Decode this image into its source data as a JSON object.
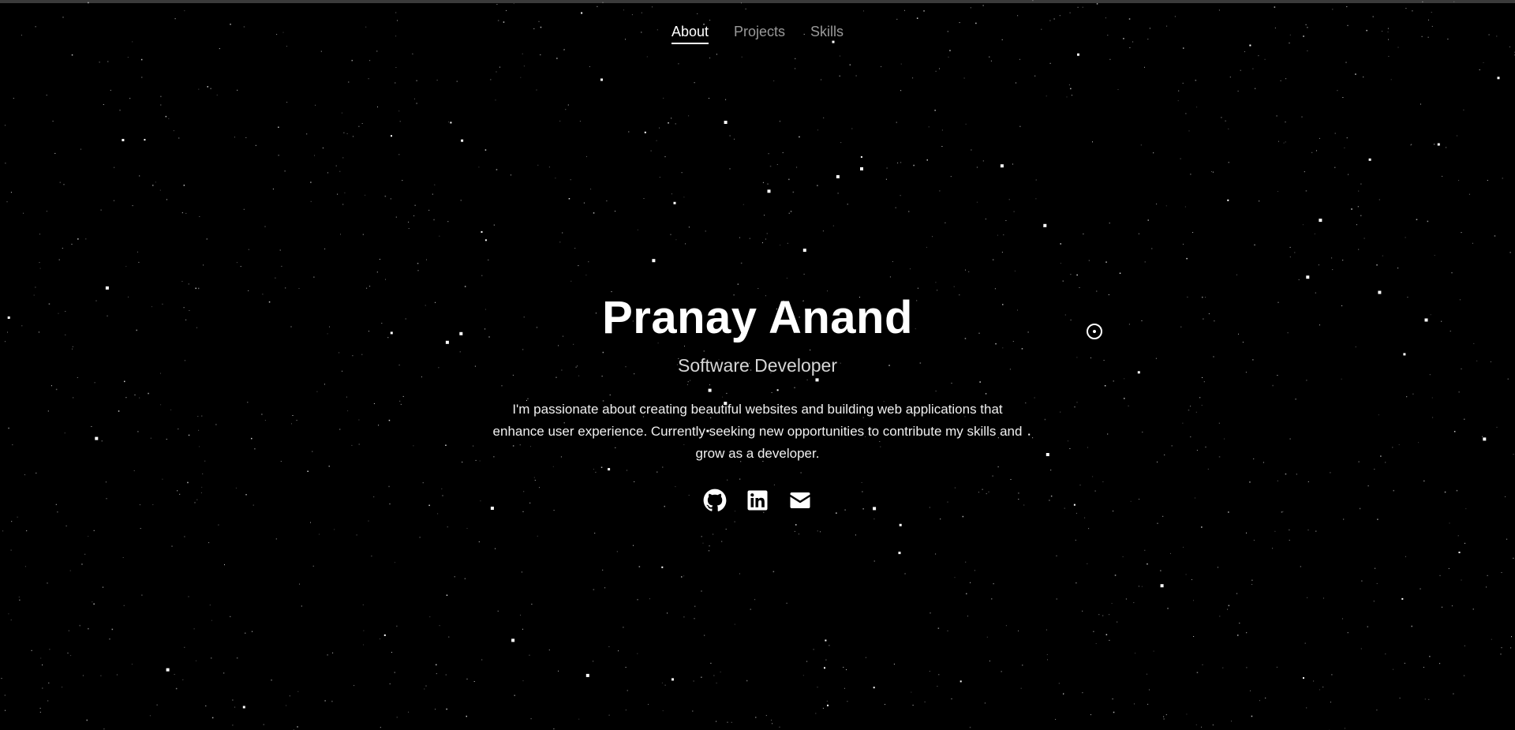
{
  "nav": {
    "items": [
      {
        "label": "About",
        "active": true
      },
      {
        "label": "Projects",
        "active": false
      },
      {
        "label": "Skills",
        "active": false
      }
    ]
  },
  "hero": {
    "name": "Pranay Anand",
    "role": "Software Developer",
    "bio": "I'm passionate about creating beautiful websites and building web applications that enhance user experience. Currently seeking new opportunities to contribute my skills and grow as a developer."
  },
  "socials": [
    {
      "icon": "github-icon"
    },
    {
      "icon": "linkedin-icon"
    },
    {
      "icon": "email-icon"
    }
  ],
  "theme": {
    "background": "#000000",
    "text": "#ffffff",
    "muted": "#9a9a9a",
    "star": "#ffffff"
  }
}
